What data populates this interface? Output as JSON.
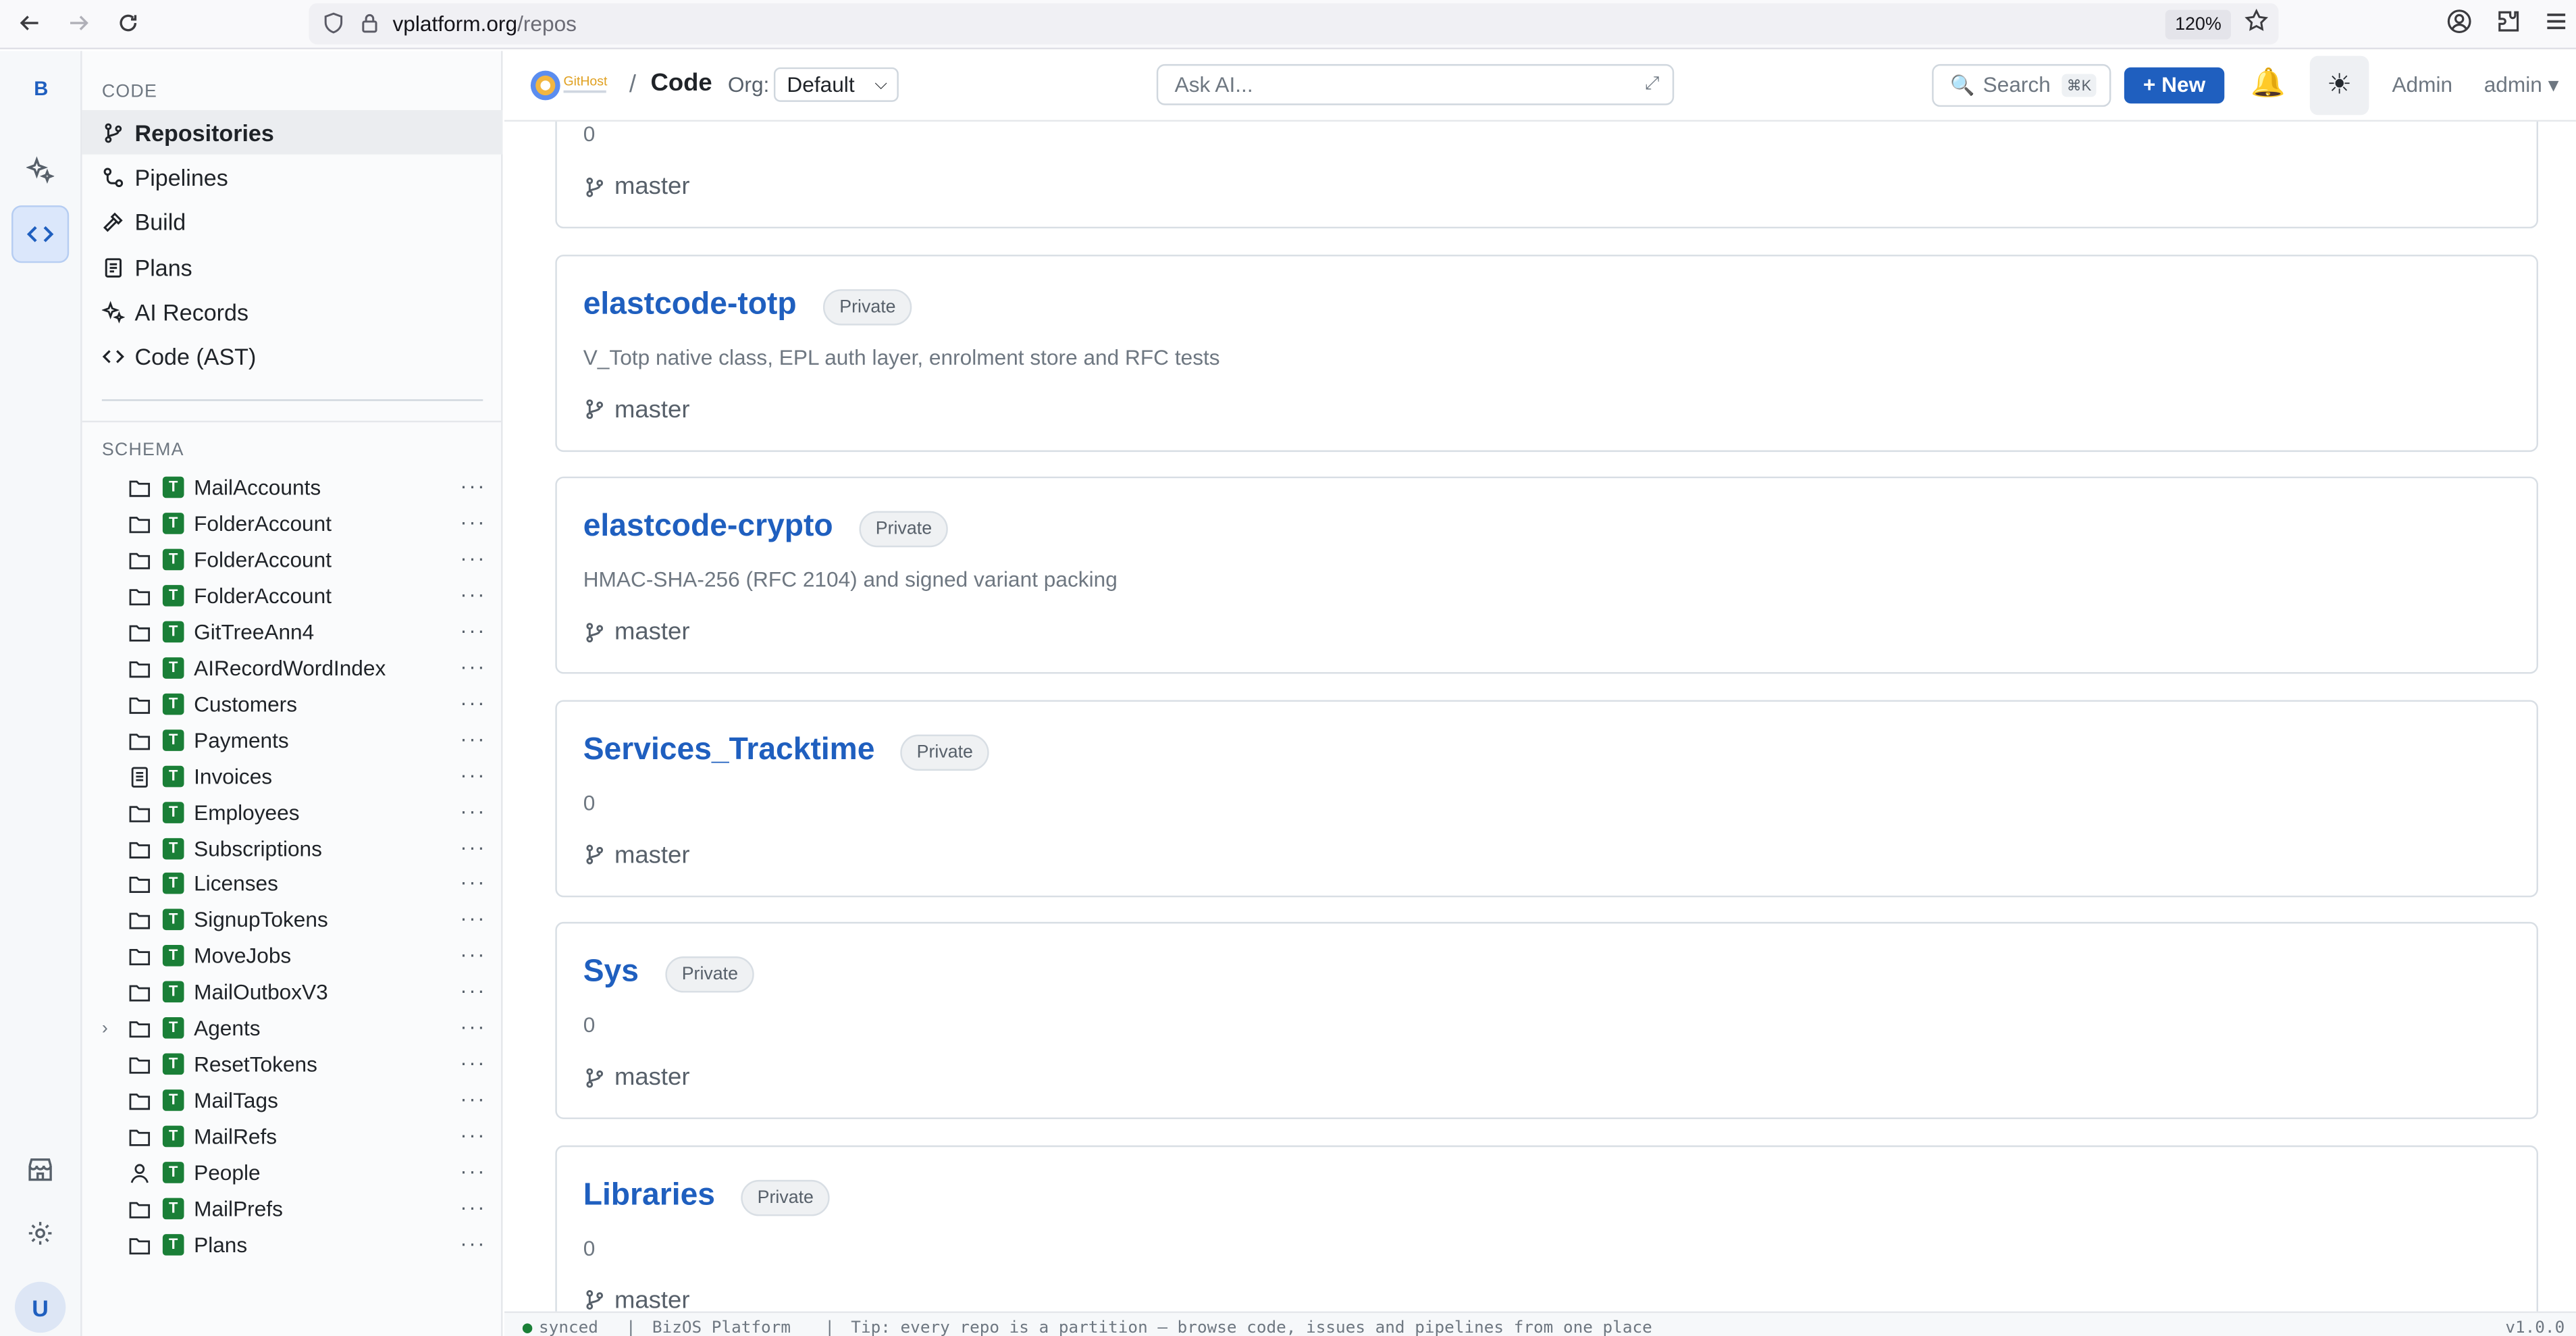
{
  "browser": {
    "url_host": "vplatform.org",
    "url_path": "/repos",
    "zoom": "120%"
  },
  "rail": {
    "brand": "B",
    "avatar": "U"
  },
  "sidebar": {
    "section_code": "CODE",
    "nav": [
      {
        "label": "Repositories",
        "icon": "branch-icon"
      },
      {
        "label": "Pipelines",
        "icon": "pipeline-icon"
      },
      {
        "label": "Build",
        "icon": "hammer-icon"
      },
      {
        "label": "Plans",
        "icon": "plans-icon"
      },
      {
        "label": "AI Records",
        "icon": "sparkles-icon"
      },
      {
        "label": "Code (AST)",
        "icon": "code-icon"
      }
    ],
    "section_schema": "SCHEMA",
    "schema": [
      {
        "name": "MailAccounts",
        "icon": "folder-icon",
        "badge": "T"
      },
      {
        "name": "FolderAccount",
        "icon": "folder-icon",
        "badge": "T"
      },
      {
        "name": "FolderAccount",
        "icon": "folder-icon",
        "badge": "T"
      },
      {
        "name": "FolderAccount",
        "icon": "folder-icon",
        "badge": "T"
      },
      {
        "name": "GitTreeAnn4",
        "icon": "folder-icon",
        "badge": "T"
      },
      {
        "name": "AIRecordWordIndex",
        "icon": "folder-icon",
        "badge": "T"
      },
      {
        "name": "Customers",
        "icon": "folder-icon",
        "badge": "T"
      },
      {
        "name": "Payments",
        "icon": "folder-icon",
        "badge": "T"
      },
      {
        "name": "Invoices",
        "icon": "document-icon",
        "badge": "T"
      },
      {
        "name": "Employees",
        "icon": "folder-icon",
        "badge": "T"
      },
      {
        "name": "Subscriptions",
        "icon": "folder-icon",
        "badge": "T"
      },
      {
        "name": "Licenses",
        "icon": "folder-icon",
        "badge": "T"
      },
      {
        "name": "SignupTokens",
        "icon": "folder-icon",
        "badge": "T"
      },
      {
        "name": "MoveJobs",
        "icon": "folder-icon",
        "badge": "T"
      },
      {
        "name": "MailOutboxV3",
        "icon": "folder-icon",
        "badge": "T"
      },
      {
        "name": "Agents",
        "icon": "folder-icon",
        "badge": "T",
        "expandable": true
      },
      {
        "name": "ResetTokens",
        "icon": "folder-icon",
        "badge": "T"
      },
      {
        "name": "MailTags",
        "icon": "folder-icon",
        "badge": "T"
      },
      {
        "name": "MailRefs",
        "icon": "folder-icon",
        "badge": "T"
      },
      {
        "name": "People",
        "icon": "person-icon",
        "badge": "T"
      },
      {
        "name": "MailPrefs",
        "icon": "folder-icon",
        "badge": "T"
      },
      {
        "name": "Plans",
        "icon": "folder-icon",
        "badge": "T"
      }
    ],
    "more_glyph": "···"
  },
  "header": {
    "logo_text": "GitHost",
    "crumb_sep": "/",
    "title": "Code",
    "org_label": "Org:",
    "org_value": "Default",
    "ask_placeholder": "Ask AI...",
    "search_label": "Search",
    "search_kbd": "⌘K",
    "new_label": "+ New",
    "admin_link": "Admin",
    "admin_menu": "admin ▾"
  },
  "repos": [
    {
      "name": "",
      "badge": "",
      "desc": "0",
      "branch": "master"
    },
    {
      "name": "elastcode-totp",
      "badge": "Private",
      "desc": "V_Totp native class, EPL auth layer, enrolment store and RFC tests",
      "branch": "master"
    },
    {
      "name": "elastcode-crypto",
      "badge": "Private",
      "desc": "HMAC-SHA-256 (RFC 2104) and signed variant packing",
      "branch": "master"
    },
    {
      "name": "Services_Tracktime",
      "badge": "Private",
      "desc": "0",
      "branch": "master"
    },
    {
      "name": "Sys",
      "badge": "Private",
      "desc": "0",
      "branch": "master"
    },
    {
      "name": "Libraries",
      "badge": "Private",
      "desc": "0",
      "branch": "master"
    }
  ],
  "status": {
    "dot": "●",
    "synced": "synced",
    "sep": "|",
    "platform": "BizOS Platform",
    "tip": "Tip: every repo is a partition — browse code, issues and pipelines from one place",
    "version": "v1.0.0"
  },
  "colors": {
    "accent": "#1f5fbf",
    "table_badge": "#1a7f37"
  }
}
